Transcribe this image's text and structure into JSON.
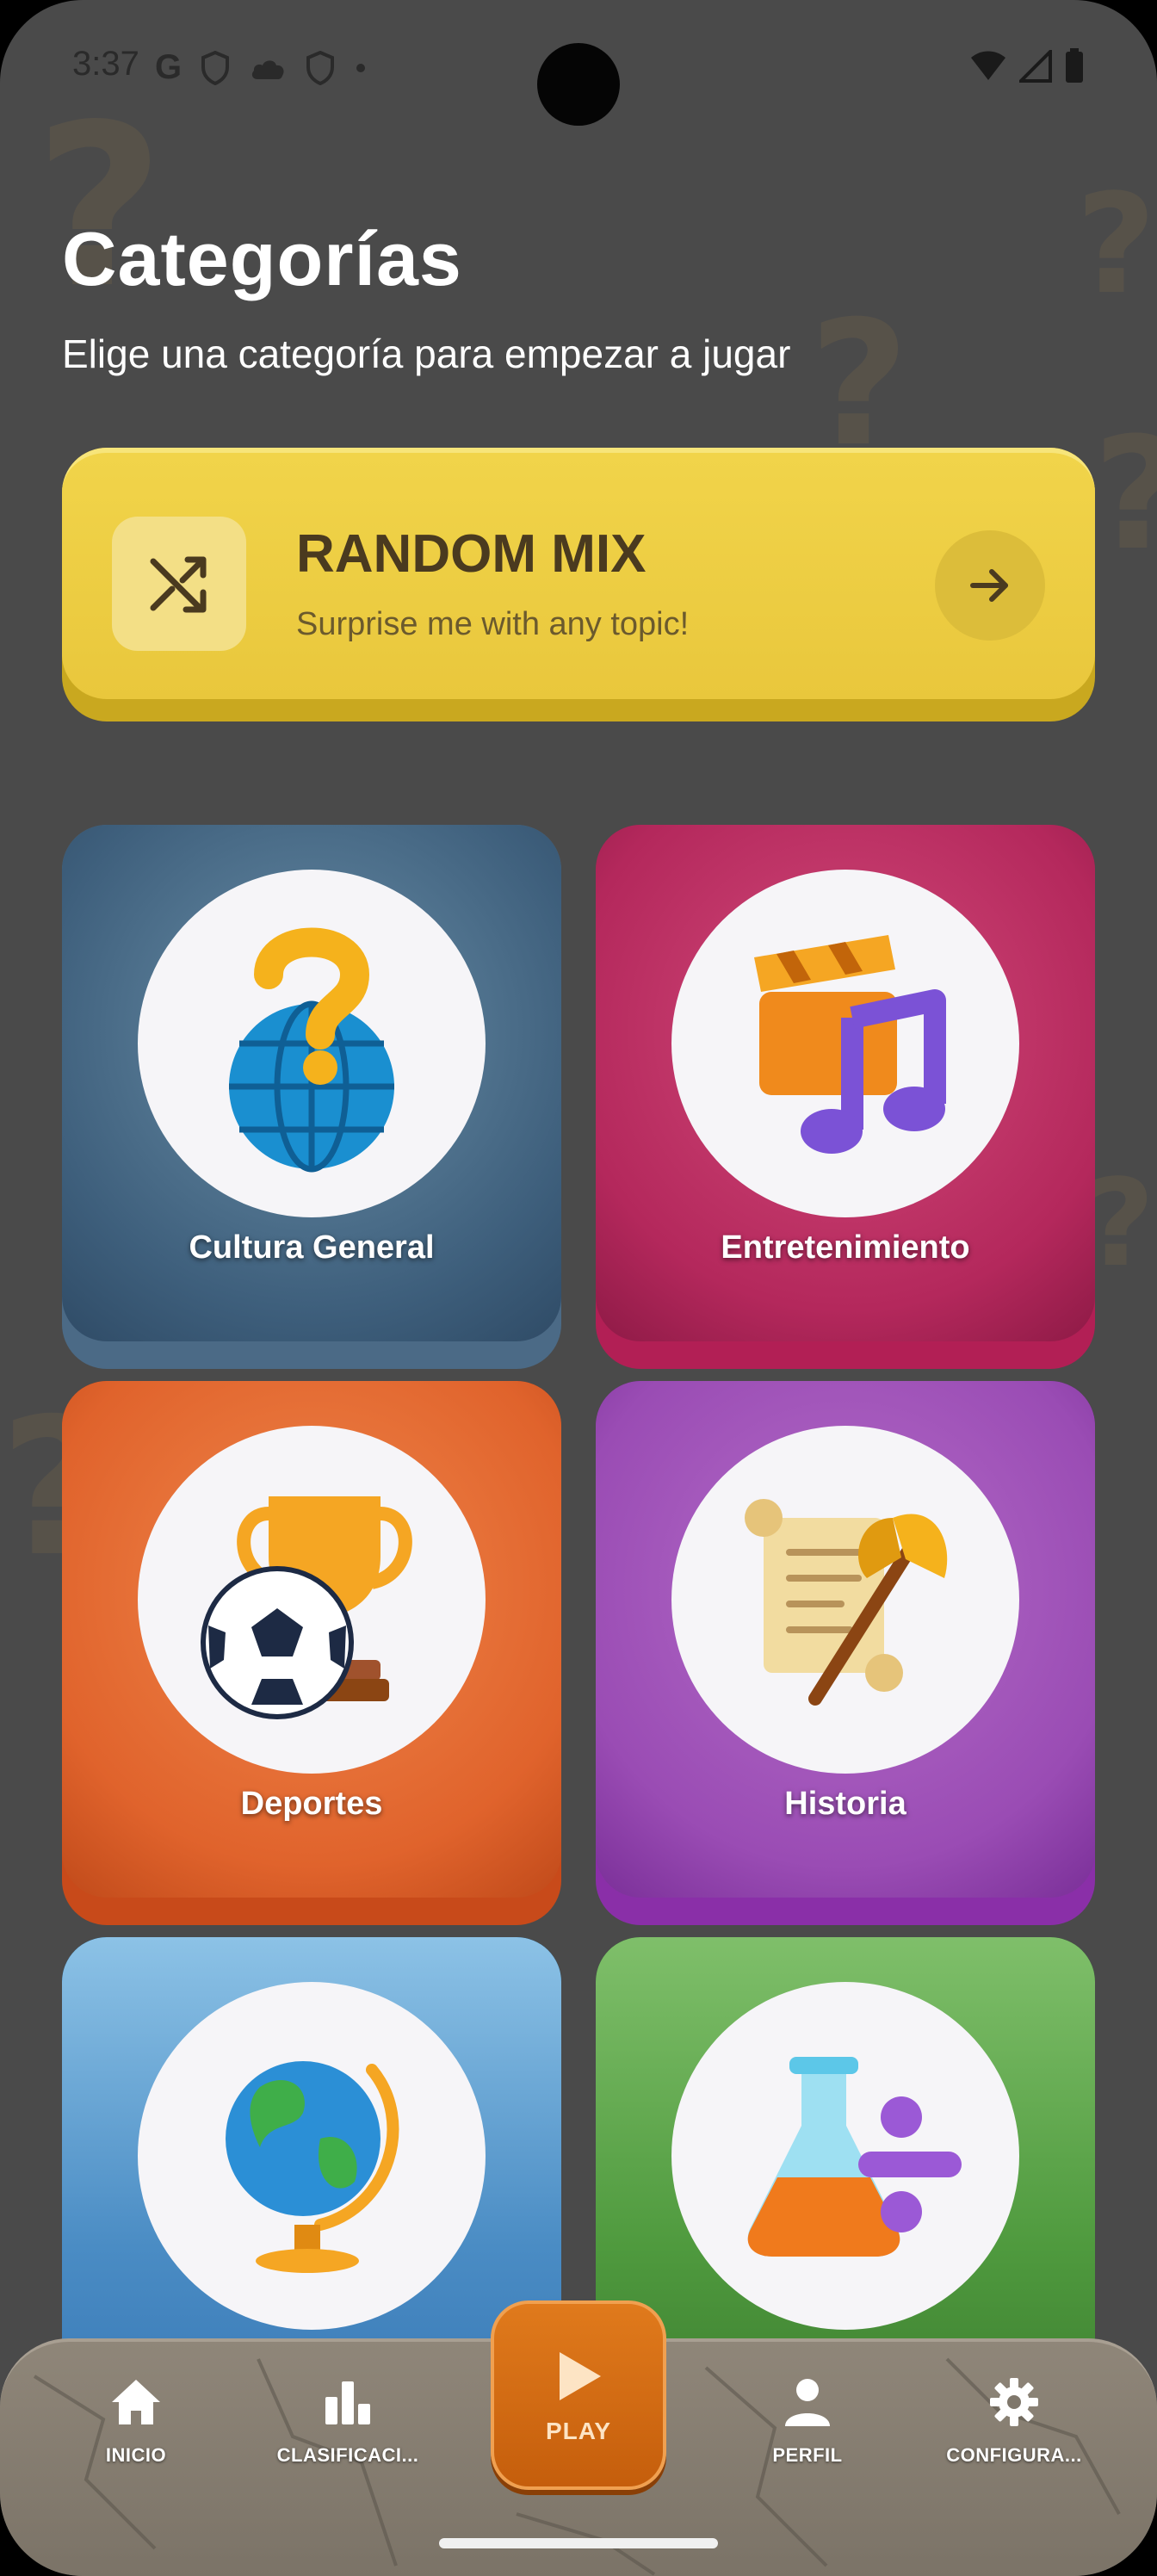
{
  "status_bar": {
    "time": "3:37"
  },
  "header": {
    "title": "Categorías",
    "subtitle": "Elige una categoría para empezar a jugar"
  },
  "random_mix": {
    "title": "RANDOM MIX",
    "subtitle": "Surprise me with any topic!"
  },
  "categories": [
    {
      "label": "Cultura General"
    },
    {
      "label": "Entretenimiento"
    },
    {
      "label": "Deportes"
    },
    {
      "label": "Historia"
    },
    {
      "label": ""
    },
    {
      "label": ""
    }
  ],
  "nav": {
    "items": [
      {
        "label": "INICIO",
        "icon": "home-icon"
      },
      {
        "label": "CLASIFICACI...",
        "icon": "bar-chart-icon"
      },
      {
        "label": "PLAY",
        "icon": "play-icon"
      },
      {
        "label": "PERFIL",
        "icon": "person-icon"
      },
      {
        "label": "CONFIGURA...",
        "icon": "gear-icon"
      }
    ]
  },
  "colors": {
    "background": "#4a4a4a",
    "random_card": "#e9c73c",
    "play_button": "#e07a1c",
    "nav_bar": "#8a8175"
  }
}
